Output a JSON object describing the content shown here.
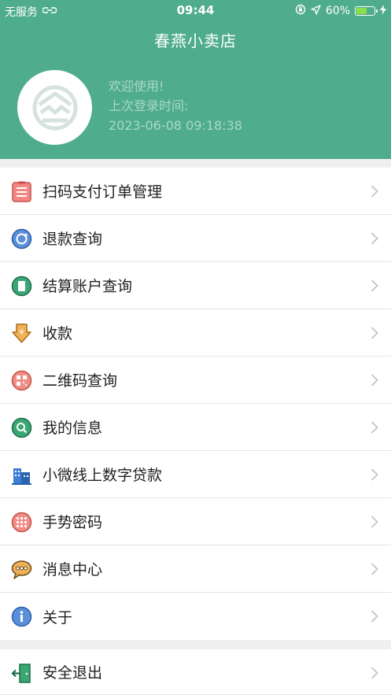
{
  "status_bar": {
    "carrier": "无服务",
    "time": "09:44",
    "battery_pct": "60%",
    "battery_level": 0.6
  },
  "header": {
    "title": "春燕小卖店",
    "welcome": "欢迎使用!",
    "last_login_label": "上次登录时间:",
    "last_login_time": "2023-06-08 09:18:38"
  },
  "menu": [
    {
      "label": "扫码支付订单管理",
      "icon": "order-list-icon"
    },
    {
      "label": "退款查询",
      "icon": "refund-icon"
    },
    {
      "label": "结算账户查询",
      "icon": "account-book-icon"
    },
    {
      "label": "收款",
      "icon": "receive-money-icon"
    },
    {
      "label": "二维码查询",
      "icon": "qrcode-icon"
    },
    {
      "label": "我的信息",
      "icon": "search-person-icon"
    },
    {
      "label": "小微线上数字贷款",
      "icon": "building-loan-icon"
    },
    {
      "label": "手势密码",
      "icon": "gesture-grid-icon"
    },
    {
      "label": "消息中心",
      "icon": "message-bubble-icon"
    },
    {
      "label": "关于",
      "icon": "info-icon"
    }
  ],
  "exit": {
    "label": "安全退出",
    "icon": "exit-door-icon"
  },
  "colors": {
    "header": "#4fac8c",
    "welcome_text": "#a9d9c6",
    "battery": "#8be04a"
  }
}
